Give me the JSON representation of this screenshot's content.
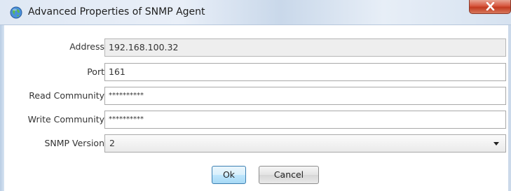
{
  "window": {
    "title": "Advanced Properties of SNMP Agent",
    "icon": "globe-icon",
    "close_icon": "close-icon"
  },
  "form": {
    "address": {
      "label": "Address",
      "value": "192.168.100.32"
    },
    "port": {
      "label": "Port",
      "value": "161"
    },
    "read_community": {
      "label": "Read Community",
      "value": "**********"
    },
    "write_community": {
      "label": "Write Community",
      "value": "**********"
    },
    "snmp_version": {
      "label": "SNMP Version",
      "value": "2"
    }
  },
  "buttons": {
    "ok": "Ok",
    "cancel": "Cancel"
  },
  "colors": {
    "close_button": "#d7573f",
    "default_button_border": "#3c7fb1"
  }
}
